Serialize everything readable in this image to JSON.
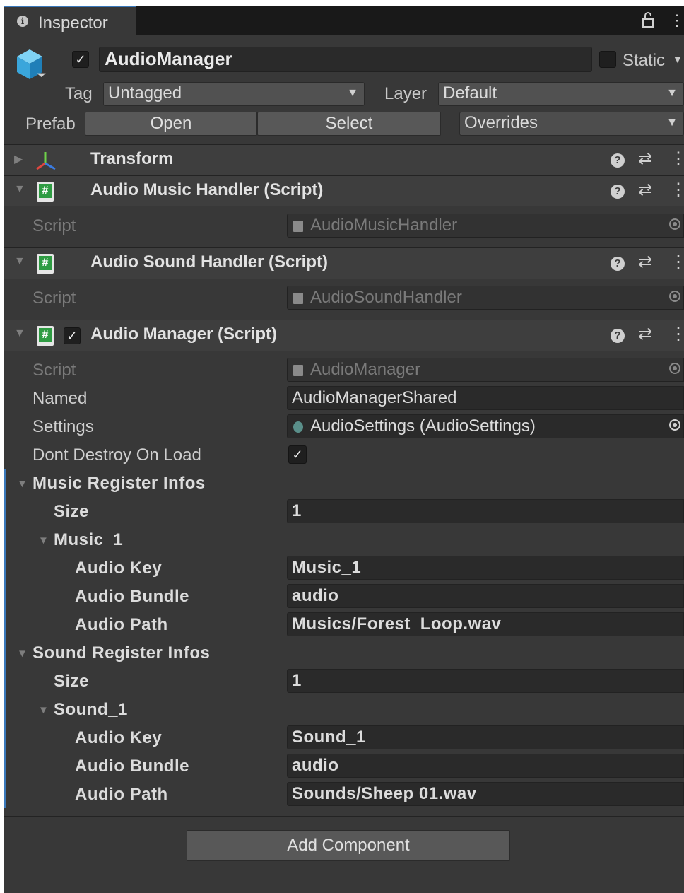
{
  "tab": {
    "title": "Inspector"
  },
  "header": {
    "object_name": "AudioManager",
    "static_label": "Static",
    "tag_label": "Tag",
    "tag_value": "Untagged",
    "layer_label": "Layer",
    "layer_value": "Default",
    "prefab_label": "Prefab",
    "open_label": "Open",
    "select_label": "Select",
    "overrides_label": "Overrides"
  },
  "components": {
    "transform": {
      "title": "Transform"
    },
    "music_handler": {
      "title": "Audio Music Handler (Script)",
      "script_label": "Script",
      "script_value": "AudioMusicHandler"
    },
    "sound_handler": {
      "title": "Audio Sound Handler (Script)",
      "script_label": "Script",
      "script_value": "AudioSoundHandler"
    },
    "audio_manager": {
      "title": "Audio Manager (Script)",
      "script_label": "Script",
      "script_value": "AudioManager",
      "named_label": "Named",
      "named_value": "AudioManagerShared",
      "settings_label": "Settings",
      "settings_value": "AudioSettings (AudioSettings)",
      "dont_destroy_label": "Dont Destroy On Load",
      "music": {
        "label": "Music Register Infos",
        "size_label": "Size",
        "size_value": "1",
        "element_label": "Music_1",
        "key_label": "Audio Key",
        "key_value": "Music_1",
        "bundle_label": "Audio Bundle",
        "bundle_value": "audio",
        "path_label": "Audio Path",
        "path_value": "Musics/Forest_Loop.wav"
      },
      "sound": {
        "label": "Sound Register Infos",
        "size_label": "Size",
        "size_value": "1",
        "element_label": "Sound_1",
        "key_label": "Audio Key",
        "key_value": "Sound_1",
        "bundle_label": "Audio Bundle",
        "bundle_value": "audio",
        "path_label": "Audio Path",
        "path_value": "Sounds/Sheep 01.wav"
      }
    }
  },
  "footer": {
    "add_component_label": "Add Component"
  },
  "icons": {
    "info": "info-icon",
    "lock": "lock-icon",
    "kebab": "kebab-menu-icon",
    "gameobject": "cube-icon",
    "transform": "transform-axes-icon",
    "script": "cs-script-icon",
    "help": "help-icon",
    "presets": "presets-icon",
    "object_picker": "object-picker-icon"
  },
  "colors": {
    "panel": "#383838",
    "accent": "#3a79bb",
    "field": "#2a2a2a",
    "script_icon": "#2f9c43"
  }
}
